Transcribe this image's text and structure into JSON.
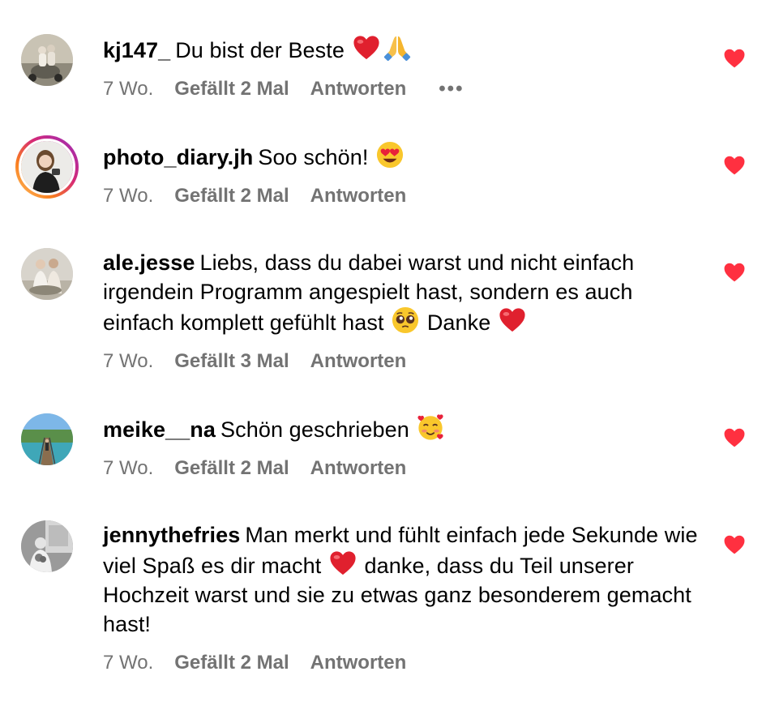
{
  "colors": {
    "like_red": "#ff3040",
    "meta_gray": "#737373"
  },
  "comments": [
    {
      "username": "kj147_",
      "text": "Du bist der Beste",
      "trailing_emojis": [
        "red-heart",
        "folded-hands"
      ],
      "time": "7 Wo.",
      "likes": "Gefällt 2 Mal",
      "reply": "Antworten",
      "more": "•••"
    },
    {
      "username": "photo_diary.jh",
      "text": "Soo schön!",
      "trailing_emojis": [
        "heart-eyes"
      ],
      "time": "7 Wo.",
      "likes": "Gefällt 2 Mal",
      "reply": "Antworten"
    },
    {
      "username": "ale.jesse",
      "text": "Liebs, dass du dabei warst und nicht einfach irgendein Programm angespielt hast, sondern es auch einfach komplett gefühlt hast",
      "text_after_emoji": "Danke",
      "trailing_emojis": [
        "pleading-face",
        "red-heart"
      ],
      "time": "7 Wo.",
      "likes": "Gefällt 3 Mal",
      "reply": "Antworten"
    },
    {
      "username": "meike__na",
      "text": "Schön geschrieben",
      "trailing_emojis": [
        "smiling-face-with-hearts"
      ],
      "time": "7 Wo.",
      "likes": "Gefällt 2 Mal",
      "reply": "Antworten"
    },
    {
      "username": "jennythefries",
      "text": "Man merkt und fühlt einfach jede Sekunde wie viel Spaß es dir macht",
      "text_after_emoji": "danke, dass du Teil unserer Hochzeit warst und sie zu etwas ganz besonderem gemacht hast!",
      "trailing_emojis": [
        "red-heart"
      ],
      "time": "7 Wo.",
      "likes": "Gefällt 2 Mal",
      "reply": "Antworten"
    }
  ]
}
